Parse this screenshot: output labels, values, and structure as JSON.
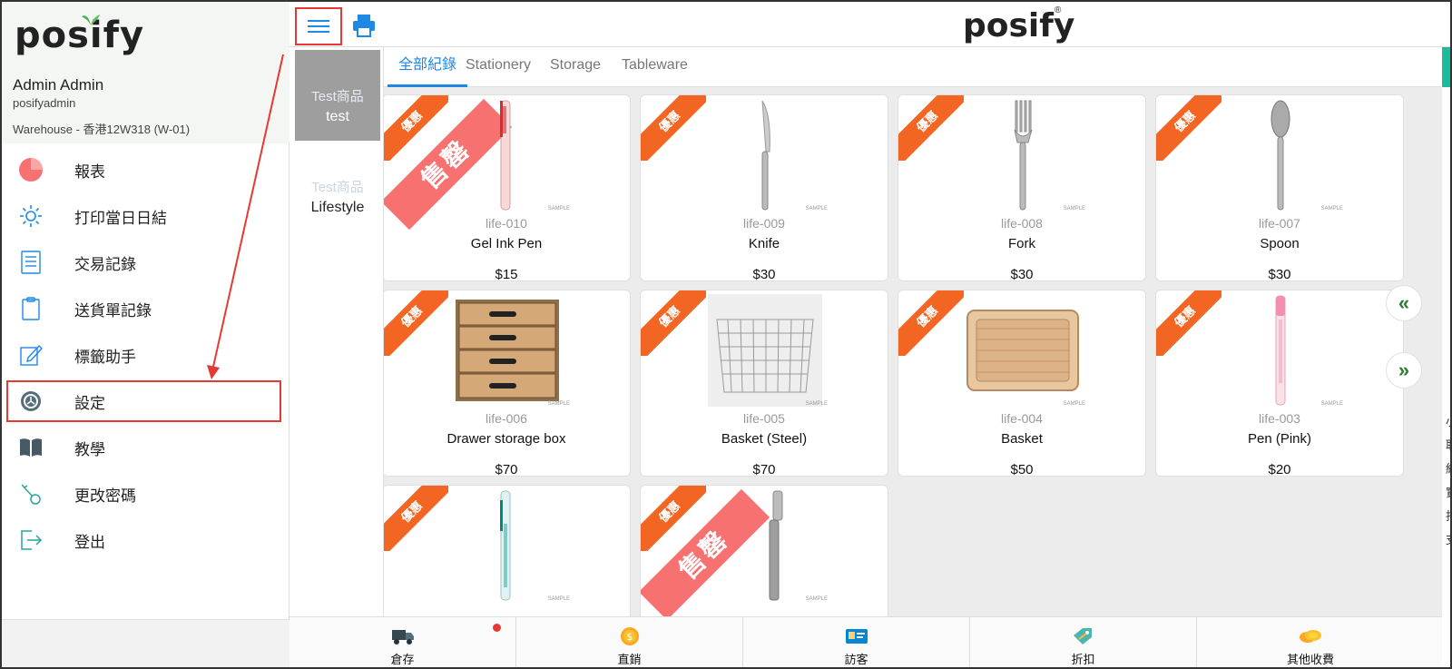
{
  "sidebar": {
    "logo": "posify",
    "user_name": "Admin Admin",
    "user_id": "posifyadmin",
    "warehouse": "Warehouse - 香港12W318 (W-01)",
    "items": [
      {
        "label": "報表",
        "icon": "pie-chart-icon"
      },
      {
        "label": "打印當日日結",
        "icon": "sun-icon"
      },
      {
        "label": "交易記錄",
        "icon": "document-icon"
      },
      {
        "label": "送貨單記錄",
        "icon": "clipboard-icon"
      },
      {
        "label": "標籤助手",
        "icon": "edit-icon"
      },
      {
        "label": "設定",
        "icon": "gear-icon"
      },
      {
        "label": "教學",
        "icon": "book-icon"
      },
      {
        "label": "更改密碼",
        "icon": "key-icon"
      },
      {
        "label": "登出",
        "icon": "logout-icon"
      }
    ]
  },
  "header": {
    "logo": "posify",
    "reg_mark": "®"
  },
  "categories": [
    {
      "line1": "Test商品",
      "line2": "test",
      "active": true
    },
    {
      "line1": "Test商品",
      "line2": "Lifestyle",
      "active": false
    }
  ],
  "tabs": [
    {
      "label": "全部紀錄",
      "active": true
    },
    {
      "label": "Stationery",
      "active": false
    },
    {
      "label": "Storage",
      "active": false
    },
    {
      "label": "Tableware",
      "active": false
    }
  ],
  "products": [
    {
      "code": "life-010",
      "name": "Gel Ink Pen",
      "price": "$15",
      "badge": "優惠",
      "sold_out": "售罄",
      "img": "pen-red"
    },
    {
      "code": "life-009",
      "name": "Knife",
      "price": "$30",
      "badge": "優惠",
      "sold_out": "",
      "img": "knife"
    },
    {
      "code": "life-008",
      "name": "Fork",
      "price": "$30",
      "badge": "優惠",
      "sold_out": "",
      "img": "fork"
    },
    {
      "code": "life-007",
      "name": "Spoon",
      "price": "$30",
      "badge": "優惠",
      "sold_out": "",
      "img": "spoon"
    },
    {
      "code": "life-006",
      "name": "Drawer storage box",
      "price": "$70",
      "badge": "優惠",
      "sold_out": "",
      "img": "drawer"
    },
    {
      "code": "life-005",
      "name": "Basket (Steel)",
      "price": "$70",
      "badge": "優惠",
      "sold_out": "",
      "img": "basket-steel"
    },
    {
      "code": "life-004",
      "name": "Basket",
      "price": "$50",
      "badge": "優惠",
      "sold_out": "",
      "img": "basket"
    },
    {
      "code": "life-003",
      "name": "Pen (Pink)",
      "price": "$20",
      "badge": "優惠",
      "sold_out": "",
      "img": "pen-pink"
    },
    {
      "code": "",
      "name": "",
      "price": "",
      "badge": "優惠",
      "sold_out": "",
      "img": "pen-green"
    },
    {
      "code": "",
      "name": "",
      "price": "",
      "badge": "優惠",
      "sold_out": "售罄",
      "img": "fountain-pen"
    }
  ],
  "sample_mark": "SAMPLE",
  "right_chars": [
    "小",
    "取",
    "結",
    "實",
    "找",
    "支"
  ],
  "bottom_bar": [
    {
      "label": "倉存",
      "icon": "truck-icon",
      "notify": true
    },
    {
      "label": "直銷",
      "icon": "coin-icon",
      "notify": false
    },
    {
      "label": "訪客",
      "icon": "id-card-icon",
      "notify": false
    },
    {
      "label": "折扣",
      "icon": "tag-icon",
      "notify": false
    },
    {
      "label": "其他收費",
      "icon": "coins-icon",
      "notify": false
    }
  ],
  "colors": {
    "accent": "#1e88e5",
    "badge": "#f26522",
    "sold_out": "#f87171",
    "annotation": "#e53935"
  }
}
